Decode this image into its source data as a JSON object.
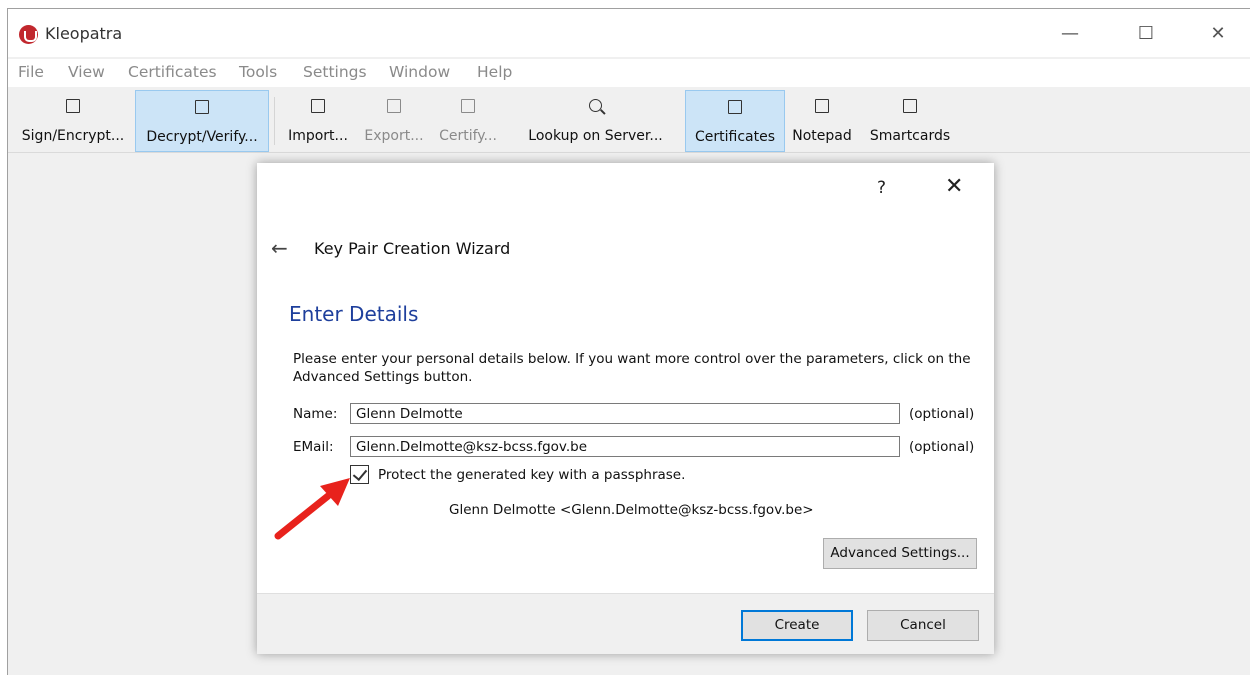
{
  "app": {
    "title": "Kleopatra"
  },
  "window_controls": {
    "minimize": "—",
    "maximize": "☐",
    "close": "✕"
  },
  "menu": [
    "File",
    "View",
    "Certificates",
    "Tools",
    "Settings",
    "Window",
    "Help"
  ],
  "toolbar": {
    "sign_encrypt": "Sign/Encrypt...",
    "decrypt_verify": "Decrypt/Verify...",
    "import": "Import...",
    "export": "Export...",
    "certify": "Certify...",
    "lookup": "Lookup on Server...",
    "certificates": "Certificates",
    "notepad": "Notepad",
    "smartcards": "Smartcards"
  },
  "dialog": {
    "help": "?",
    "close": "✕",
    "back": "←",
    "wizard_title": "Key Pair Creation Wizard",
    "section_title": "Enter Details",
    "instructions": "Please enter your personal details below. If you want more control over the parameters, click on the Advanced Settings button.",
    "name_label": "Name:",
    "name_value": "Glenn Delmotte",
    "email_label": "EMail:",
    "email_value": "Glenn.Delmotte@ksz-bcss.fgov.be",
    "optional": "(optional)",
    "passphrase_label": "Protect the generated key with a passphrase.",
    "passphrase_checked": true,
    "user_id_preview": "Glenn Delmotte <Glenn.Delmotte@ksz-bcss.fgov.be>",
    "advanced_button": "Advanced Settings...",
    "create_button": "Create",
    "cancel_button": "Cancel"
  },
  "colors": {
    "accent": "#0078d7",
    "section_title": "#1e3f9c",
    "active_toolbar": "#cce4f7",
    "annotation_arrow": "#e8221c"
  }
}
